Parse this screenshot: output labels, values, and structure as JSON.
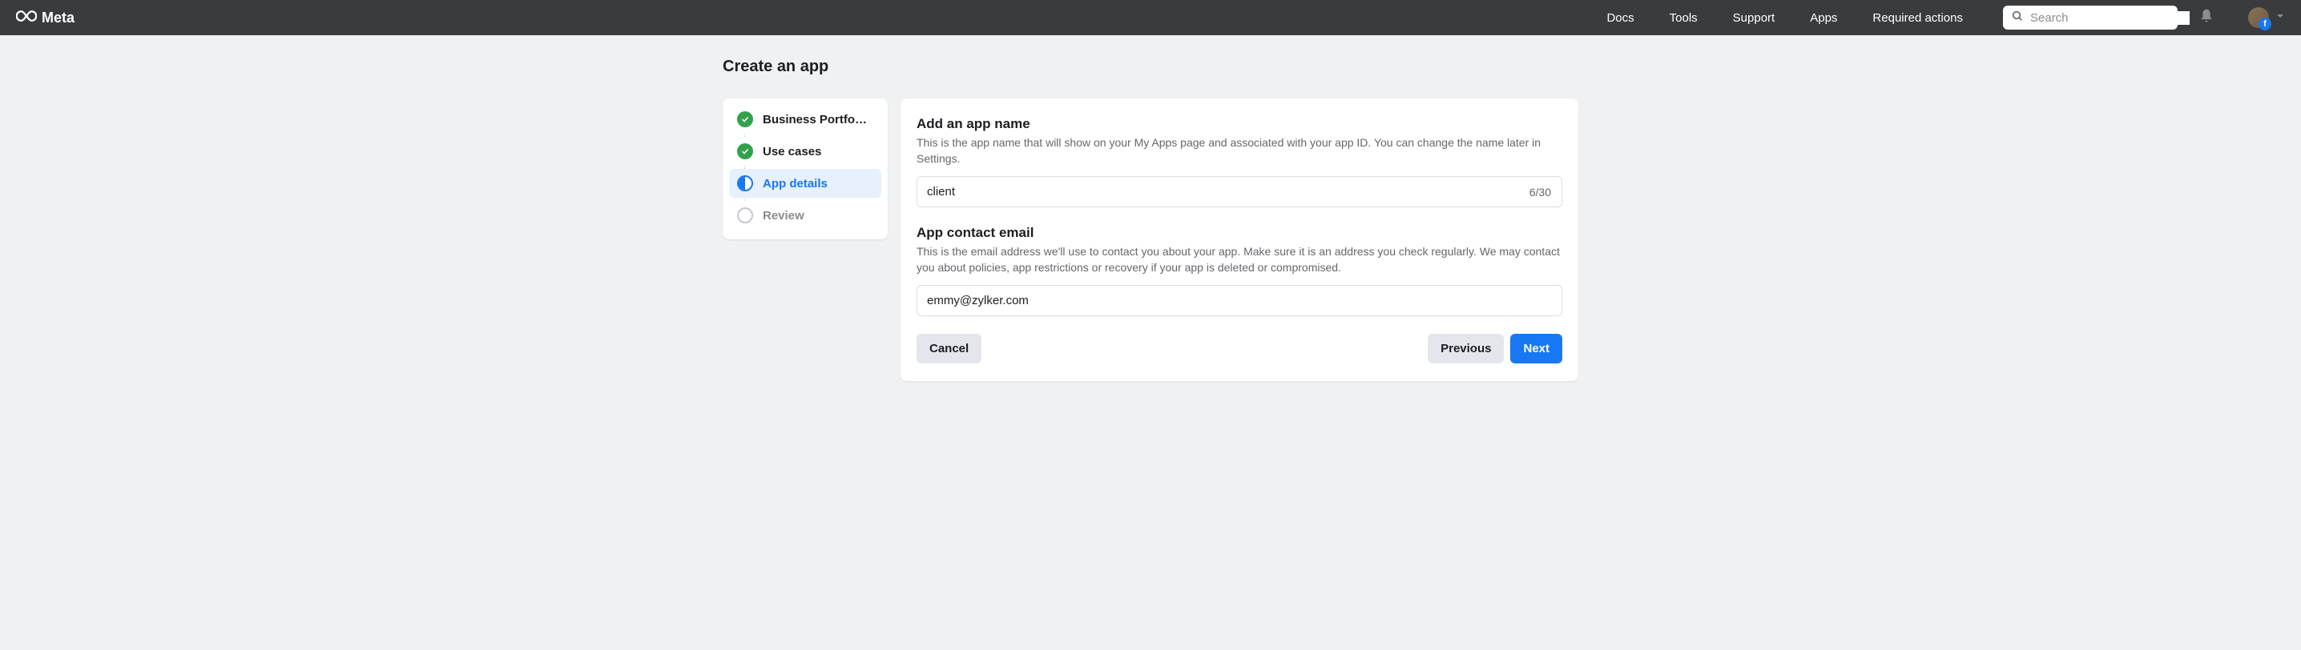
{
  "header": {
    "brand": "Meta",
    "nav": {
      "docs": "Docs",
      "tools": "Tools",
      "support": "Support",
      "apps": "Apps",
      "required_actions": "Required actions"
    },
    "search_placeholder": "Search"
  },
  "page": {
    "title": "Create an app"
  },
  "steps": [
    {
      "label": "Business Portfo…",
      "state": "done"
    },
    {
      "label": "Use cases",
      "state": "done"
    },
    {
      "label": "App details",
      "state": "active"
    },
    {
      "label": "Review",
      "state": "pending"
    }
  ],
  "form": {
    "app_name": {
      "label": "Add an app name",
      "description": "This is the app name that will show on your My Apps page and associated with your app ID. You can change the name later in Settings.",
      "value": "client",
      "counter": "6/30"
    },
    "email": {
      "label": "App contact email",
      "description": "This is the email address we'll use to contact you about your app. Make sure it is an address you check regularly. We may contact you about policies, app restrictions or recovery if your app is deleted or compromised.",
      "value": "emmy@zylker.com"
    }
  },
  "buttons": {
    "cancel": "Cancel",
    "previous": "Previous",
    "next": "Next"
  }
}
